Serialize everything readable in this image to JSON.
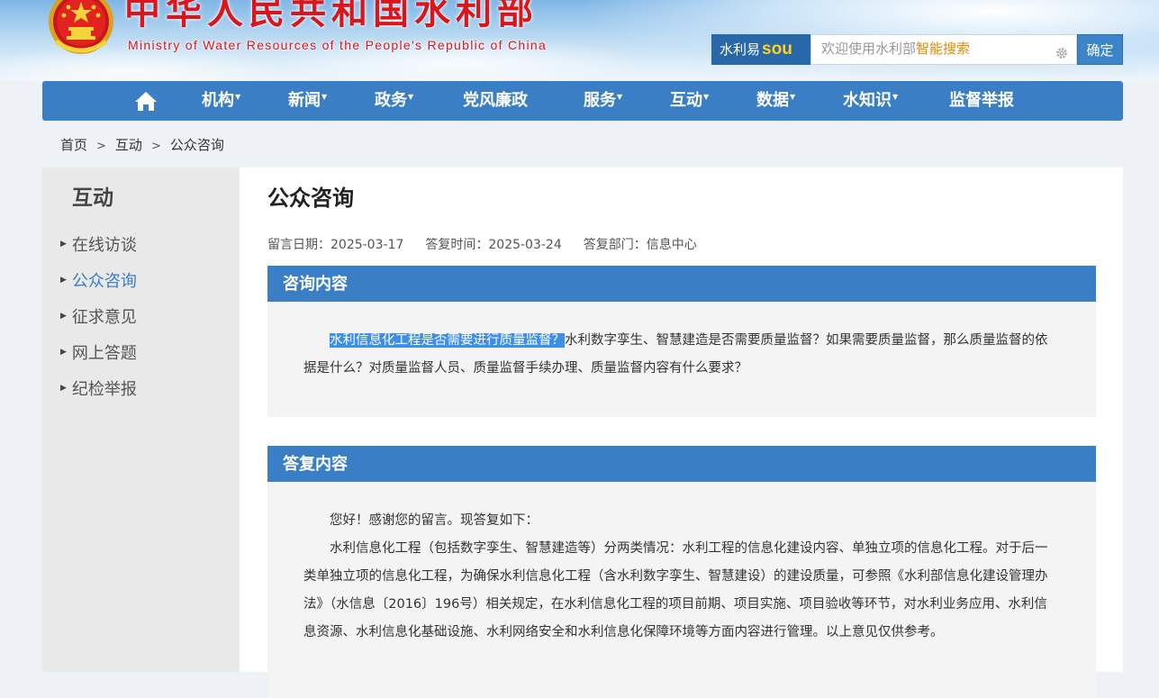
{
  "header": {
    "title": "中华人民共和国水利部",
    "subtitle": "Ministry of Water Resources of the People's Republic of China",
    "accent_color": "#d8161b"
  },
  "search": {
    "brand_prefix": "水利易",
    "brand_suffix": "sou",
    "placeholder_prefix": "欢迎使用水利部",
    "placeholder_highlight": "智能搜索",
    "submit_label": "确定",
    "settings_icon": "gear-icon"
  },
  "nav": {
    "home_icon": "home-icon",
    "items": [
      {
        "label": "机构",
        "dropdown": true
      },
      {
        "label": "新闻",
        "dropdown": true
      },
      {
        "label": "政务",
        "dropdown": true
      },
      {
        "label": "党风廉政",
        "dropdown": false
      },
      {
        "label": "服务",
        "dropdown": true
      },
      {
        "label": "互动",
        "dropdown": true
      },
      {
        "label": "数据",
        "dropdown": true
      },
      {
        "label": "水知识",
        "dropdown": true
      },
      {
        "label": "监督举报",
        "dropdown": false
      }
    ],
    "color": "#3a7fc6"
  },
  "breadcrumb": {
    "items": [
      "首页",
      "互动",
      "公众咨询"
    ],
    "separator": ">"
  },
  "sidebar": {
    "heading": "互动",
    "items": [
      {
        "label": "在线访谈",
        "active": false
      },
      {
        "label": "公众咨询",
        "active": true
      },
      {
        "label": "征求意见",
        "active": false
      },
      {
        "label": "网上答题",
        "active": false
      },
      {
        "label": "纪检举报",
        "active": false
      }
    ]
  },
  "article": {
    "title": "公众咨询",
    "meta": {
      "message_date": "留言日期：2025-03-17",
      "reply_time": "答复时间：2025-03-24",
      "reply_dept": "答复部门：信息中心"
    },
    "question": {
      "heading": "咨询内容",
      "selected_text": "水利信息化工程是否需要进行质量监督？",
      "text_rest": "水利数字孪生、智慧建造是否需要质量监督？如果需要质量监督，那么质量监督的依据是什么？对质量监督人员、质量监督手续办理、质量监督内容有什么要求？"
    },
    "answer": {
      "heading": "答复内容",
      "greeting": "您好！感谢您的留言。现答复如下：",
      "body": "水利信息化工程（包括数字孪生、智慧建造等）分两类情况：水利工程的信息化建设内容、单独立项的信息化工程。对于后一类单独立项的信息化工程，为确保水利信息化工程（含水利数字孪生、智慧建设）的建设质量，可参照《水利部信息化建设管理办法》（水信息〔2016〕196号）相关规定，在水利信息化工程的项目前期、项目实施、项目验收等环节，对水利业务应用、水利信息资源、水利信息化基础设施、水利网络安全和水利信息化保障环境等方面内容进行管理。以上意见仅供参考。"
    }
  }
}
